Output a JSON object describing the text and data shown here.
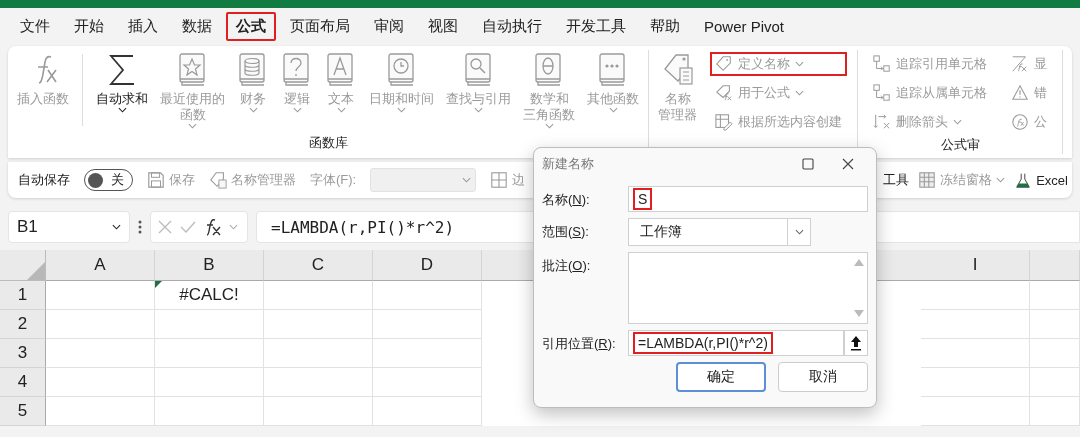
{
  "menu_tabs": [
    {
      "label": "文件",
      "selected": false,
      "highlighted": false
    },
    {
      "label": "开始",
      "selected": false,
      "highlighted": false
    },
    {
      "label": "插入",
      "selected": false,
      "highlighted": false
    },
    {
      "label": "数据",
      "selected": false,
      "highlighted": false
    },
    {
      "label": "公式",
      "selected": true,
      "highlighted": true
    },
    {
      "label": "页面布局",
      "selected": false,
      "highlighted": false
    },
    {
      "label": "审阅",
      "selected": false,
      "highlighted": false
    },
    {
      "label": "视图",
      "selected": false,
      "highlighted": false
    },
    {
      "label": "自动执行",
      "selected": false,
      "highlighted": false
    },
    {
      "label": "开发工具",
      "selected": false,
      "highlighted": false
    },
    {
      "label": "帮助",
      "selected": false,
      "highlighted": false
    },
    {
      "label": "Power Pivot",
      "selected": false,
      "highlighted": false
    }
  ],
  "ribbon": {
    "groups": [
      {
        "label": "函数库",
        "large_buttons": [
          {
            "kind": "fx",
            "lines": [
              "插入函数"
            ],
            "has_menu": false,
            "disabled": true,
            "separator_after": true
          },
          {
            "kind": "sigma",
            "lines": [
              "自动求和"
            ],
            "has_menu": true,
            "disabled": false,
            "separator_after": false
          },
          {
            "kind": "star",
            "lines": [
              "最近使用的",
              "函数"
            ],
            "has_menu": true,
            "disabled": true,
            "separator_after": false
          },
          {
            "kind": "coins",
            "lines": [
              "财务"
            ],
            "has_menu": true,
            "disabled": true,
            "separator_after": false
          },
          {
            "kind": "question",
            "lines": [
              "逻辑"
            ],
            "has_menu": true,
            "disabled": true,
            "separator_after": false
          },
          {
            "kind": "letter",
            "lines": [
              "文本"
            ],
            "has_menu": true,
            "disabled": true,
            "separator_after": false
          },
          {
            "kind": "clock",
            "lines": [
              "日期和时间"
            ],
            "has_menu": true,
            "disabled": true,
            "separator_after": false
          },
          {
            "kind": "search",
            "lines": [
              "查找与引用"
            ],
            "has_menu": true,
            "disabled": true,
            "separator_after": false
          },
          {
            "kind": "theta",
            "lines": [
              "数学和",
              "三角函数"
            ],
            "has_menu": true,
            "disabled": true,
            "separator_after": false
          },
          {
            "kind": "dots",
            "lines": [
              "其他函数"
            ],
            "has_menu": true,
            "disabled": true,
            "separator_after": false
          }
        ]
      },
      {
        "large_buttons": [
          {
            "kind": "name-manager",
            "lines": [
              "名称",
              "管理器"
            ],
            "has_menu": false,
            "disabled": true
          }
        ],
        "small_columns": [
          [
            {
              "kind": "tag",
              "label": "定义名称",
              "has_menu": true,
              "disabled": true,
              "highlighted": true
            },
            {
              "kind": "tag-fx",
              "label": "用于公式",
              "has_menu": true,
              "disabled": true,
              "highlighted": false
            },
            {
              "kind": "grid-create",
              "label": "根据所选内容创建",
              "has_menu": false,
              "disabled": true,
              "highlighted": false
            }
          ]
        ]
      },
      {
        "label": "公式审",
        "small_columns": [
          [
            {
              "kind": "trace",
              "label": "追踪引用单元格",
              "has_menu": false,
              "disabled": true,
              "highlighted": false
            },
            {
              "kind": "trace",
              "label": "追踪从属单元格",
              "has_menu": false,
              "disabled": true,
              "highlighted": false
            },
            {
              "kind": "remove-arrows",
              "label": "删除箭头",
              "has_menu": true,
              "disabled": true,
              "highlighted": false
            }
          ],
          [
            {
              "kind": "show-formulas",
              "label": "显",
              "has_menu": false,
              "disabled": true,
              "highlighted": false
            },
            {
              "kind": "warning",
              "label": "错",
              "has_menu": false,
              "disabled": true,
              "highlighted": false
            },
            {
              "kind": "evaluate",
              "label": "公",
              "has_menu": false,
              "disabled": true,
              "highlighted": false
            }
          ]
        ]
      }
    ]
  },
  "quick_access": {
    "autosave": {
      "label": "自动保存",
      "on": false,
      "state_label": "关"
    },
    "items": [
      {
        "kind": "save",
        "label": "保存",
        "disabled": true,
        "has_menu": false
      },
      {
        "kind": "name-manager",
        "label": "名称管理器",
        "disabled": true,
        "has_menu": false
      },
      {
        "kind": "dropdown",
        "label": "字体(F):",
        "disabled": true
      },
      {
        "kind": "borders",
        "label": "边",
        "disabled": true,
        "has_menu": false
      }
    ],
    "right_items": [
      {
        "kind": "text",
        "label": "工具",
        "disabled": false,
        "has_menu": false
      },
      {
        "kind": "freeze",
        "label": "冻结窗格",
        "disabled": true,
        "has_menu": true
      },
      {
        "kind": "beaker",
        "label": "Excel",
        "disabled": false,
        "has_menu": false
      }
    ]
  },
  "formula_bar": {
    "name_box": "B1",
    "formula": "=LAMBDA(r,PI()*r^2)"
  },
  "sheet": {
    "columns": [
      {
        "label": "A",
        "gap_before": false
      },
      {
        "label": "B",
        "gap_before": false,
        "cells": [
          {
            "value": "#CALC!",
            "error": true
          }
        ]
      },
      {
        "label": "C",
        "gap_before": false
      },
      {
        "label": "D",
        "gap_before": false
      },
      {
        "label": "I",
        "gap_before": true
      }
    ],
    "rows": [
      "1",
      "2",
      "3",
      "4",
      "5"
    ]
  },
  "dialog": {
    "title": "新建名称",
    "fields": [
      {
        "kind": "text",
        "label": "名称(",
        "accel": "N",
        "label_end": "):",
        "value": "S",
        "highlighted": true
      },
      {
        "kind": "dropdown",
        "label": "范围(",
        "accel": "S",
        "label_end": "):",
        "value": "工作簿",
        "highlighted": false
      },
      {
        "kind": "textarea",
        "label": "批注(",
        "accel": "O",
        "label_end": "):"
      },
      {
        "kind": "reference",
        "label": "引用位置(",
        "accel": "R",
        "label_end": "):",
        "value": "=LAMBDA(r,PI()*r^2)",
        "highlighted": true
      }
    ],
    "buttons": [
      {
        "label": "确定",
        "default": true
      },
      {
        "label": "取消",
        "default": false
      }
    ]
  }
}
